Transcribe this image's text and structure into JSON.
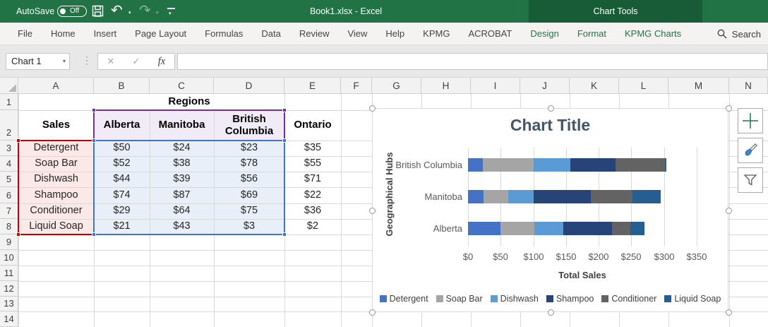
{
  "titlebar": {
    "autosave_label": "AutoSave",
    "autosave_state": "Off",
    "document_title": "Book1.xlsx  -  Excel",
    "contextual_tab_group": "Chart Tools"
  },
  "ribbon": {
    "tabs": [
      {
        "label": "File",
        "contextual": false
      },
      {
        "label": "Home",
        "contextual": false
      },
      {
        "label": "Insert",
        "contextual": false
      },
      {
        "label": "Page Layout",
        "contextual": false
      },
      {
        "label": "Formulas",
        "contextual": false
      },
      {
        "label": "Data",
        "contextual": false
      },
      {
        "label": "Review",
        "contextual": false
      },
      {
        "label": "View",
        "contextual": false
      },
      {
        "label": "Help",
        "contextual": false
      },
      {
        "label": "KPMG",
        "contextual": false
      },
      {
        "label": "ACROBAT",
        "contextual": false
      },
      {
        "label": "Design",
        "contextual": true
      },
      {
        "label": "Format",
        "contextual": true
      },
      {
        "label": "KPMG Charts",
        "contextual": true
      }
    ],
    "search_label": "Search",
    "contextual_color": "#217346"
  },
  "formula_bar": {
    "name_box_value": "Chart 1",
    "fx_label": "fx",
    "formula_value": ""
  },
  "grid": {
    "column_letters": [
      "A",
      "B",
      "C",
      "D",
      "E",
      "F",
      "G",
      "H",
      "I",
      "J",
      "K",
      "L",
      "M",
      "N"
    ],
    "row_numbers": [
      "1",
      "2",
      "3",
      "4",
      "5",
      "6",
      "7",
      "8",
      "9",
      "10",
      "11",
      "12",
      "13",
      "14"
    ]
  },
  "sheet_table": {
    "regions_label": "Regions",
    "sales_header": "Sales",
    "region_headers": [
      "Alberta",
      "Manitoba",
      "British Columbia",
      "Ontario"
    ],
    "rows": [
      {
        "label": "Detergent",
        "values": [
          "$50",
          "$24",
          "$23",
          "$35"
        ]
      },
      {
        "label": "Soap Bar",
        "values": [
          "$52",
          "$38",
          "$78",
          "$55"
        ]
      },
      {
        "label": "Dishwash",
        "values": [
          "$44",
          "$39",
          "$56",
          "$71"
        ]
      },
      {
        "label": "Shampoo",
        "values": [
          "$74",
          "$87",
          "$69",
          "$22"
        ]
      },
      {
        "label": "Conditioner",
        "values": [
          "$29",
          "$64",
          "$75",
          "$36"
        ]
      },
      {
        "label": "Liquid Soap",
        "values": [
          "$21",
          "$43",
          "$3",
          "$2"
        ]
      }
    ],
    "fills": {
      "row_labels": "#FCE9E7",
      "data": "#E9EFF8",
      "region_header": "#F1EBF8"
    },
    "range_border_colors": {
      "labels": "#C00000",
      "data": "#4472C4",
      "header": "#7030A0"
    }
  },
  "chart_data": {
    "type": "bar",
    "orientation": "horizontal",
    "stacked": true,
    "title": "Chart Title",
    "title_color": "#44546A",
    "xlabel": "Total Sales",
    "ylabel": "Geographical Hubs",
    "categories": [
      "British Columbia",
      "Manitoba",
      "Alberta"
    ],
    "series": [
      {
        "name": "Detergent",
        "color": "#4472C4",
        "values": [
          23,
          24,
          50
        ]
      },
      {
        "name": "Soap Bar",
        "color": "#A5A5A5",
        "values": [
          78,
          38,
          52
        ]
      },
      {
        "name": "Dishwash",
        "color": "#5B9BD5",
        "values": [
          56,
          39,
          44
        ]
      },
      {
        "name": "Shampoo",
        "color": "#264478",
        "values": [
          69,
          87,
          74
        ]
      },
      {
        "name": "Conditioner",
        "color": "#636363",
        "values": [
          75,
          64,
          29
        ]
      },
      {
        "name": "Liquid Soap",
        "color": "#255E91",
        "values": [
          3,
          43,
          21
        ]
      }
    ],
    "xlim": [
      0,
      350
    ],
    "x_ticks": [
      "$0",
      "$50",
      "$100",
      "$150",
      "$200",
      "$250",
      "$300",
      "$350"
    ],
    "legend_position": "bottom",
    "gridlines": true
  },
  "side_buttons": [
    {
      "name": "chart-elements-button",
      "icon": "plus-icon"
    },
    {
      "name": "chart-styles-button",
      "icon": "brush-icon"
    },
    {
      "name": "chart-filters-button",
      "icon": "funnel-icon"
    }
  ]
}
